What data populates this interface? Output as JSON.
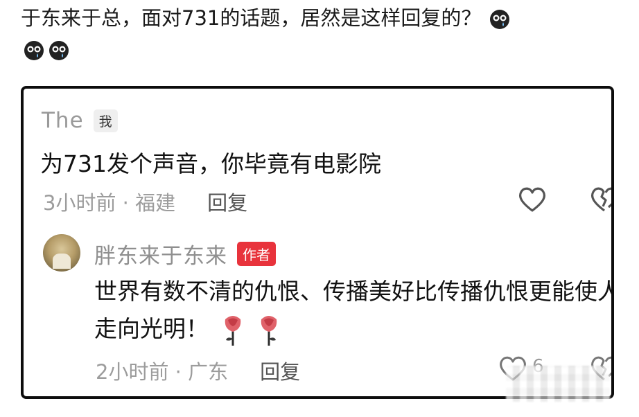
{
  "headline": "于东来于总，面对731的话题，居然是这样回复的？",
  "comment1": {
    "username": "The",
    "badge": "我",
    "text": "为731发个声音，你毕竟有电影院",
    "meta": "3小时前 · 福建",
    "reply_label": "回复"
  },
  "comment2": {
    "username": "胖东来于东来",
    "badge": "作者",
    "text": "世界有数不清的仇恨、传播美好比传播仇恨更能使人走向光明！",
    "meta": "2小时前 · 广东",
    "reply_label": "回复",
    "like_count": "6",
    "rose_count": 2
  },
  "icons": {
    "emoji": "crying-face-icon",
    "like": "heart-icon",
    "dislike": "broken-heart-icon",
    "reaction": "rose-icon"
  },
  "colors": {
    "author_badge": "#e8333c",
    "meta_text": "#9c9c9c",
    "card_border": "#0d0d0d"
  }
}
